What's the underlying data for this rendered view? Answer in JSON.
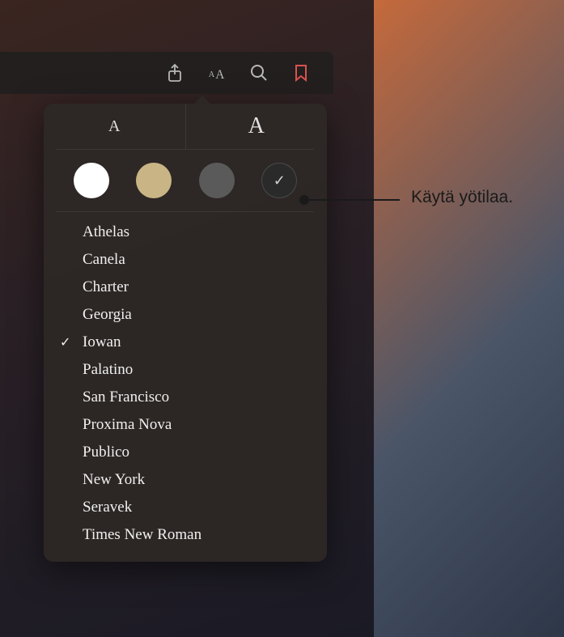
{
  "toolbar": {
    "share_icon": "share-icon",
    "appearance_icon": "text-appearance-icon",
    "search_icon": "search-icon",
    "bookmark_icon": "bookmark-icon"
  },
  "size": {
    "small": "A",
    "large": "A"
  },
  "themes": {
    "white": "#ffffff",
    "sepia": "#c9b485",
    "gray": "#5a5a5a",
    "night": "#2a2a2a",
    "selected": "night"
  },
  "fonts": {
    "items": [
      {
        "label": "Athelas",
        "selected": false
      },
      {
        "label": "Canela",
        "selected": false
      },
      {
        "label": "Charter",
        "selected": false
      },
      {
        "label": "Georgia",
        "selected": false
      },
      {
        "label": "Iowan",
        "selected": true
      },
      {
        "label": "Palatino",
        "selected": false
      },
      {
        "label": "San Francisco",
        "selected": false
      },
      {
        "label": "Proxima Nova",
        "selected": false
      },
      {
        "label": "Publico",
        "selected": false
      },
      {
        "label": "New York",
        "selected": false
      },
      {
        "label": "Seravek",
        "selected": false
      },
      {
        "label": "Times New Roman",
        "selected": false
      }
    ]
  },
  "callout": {
    "text": "Käytä yötilaa."
  }
}
